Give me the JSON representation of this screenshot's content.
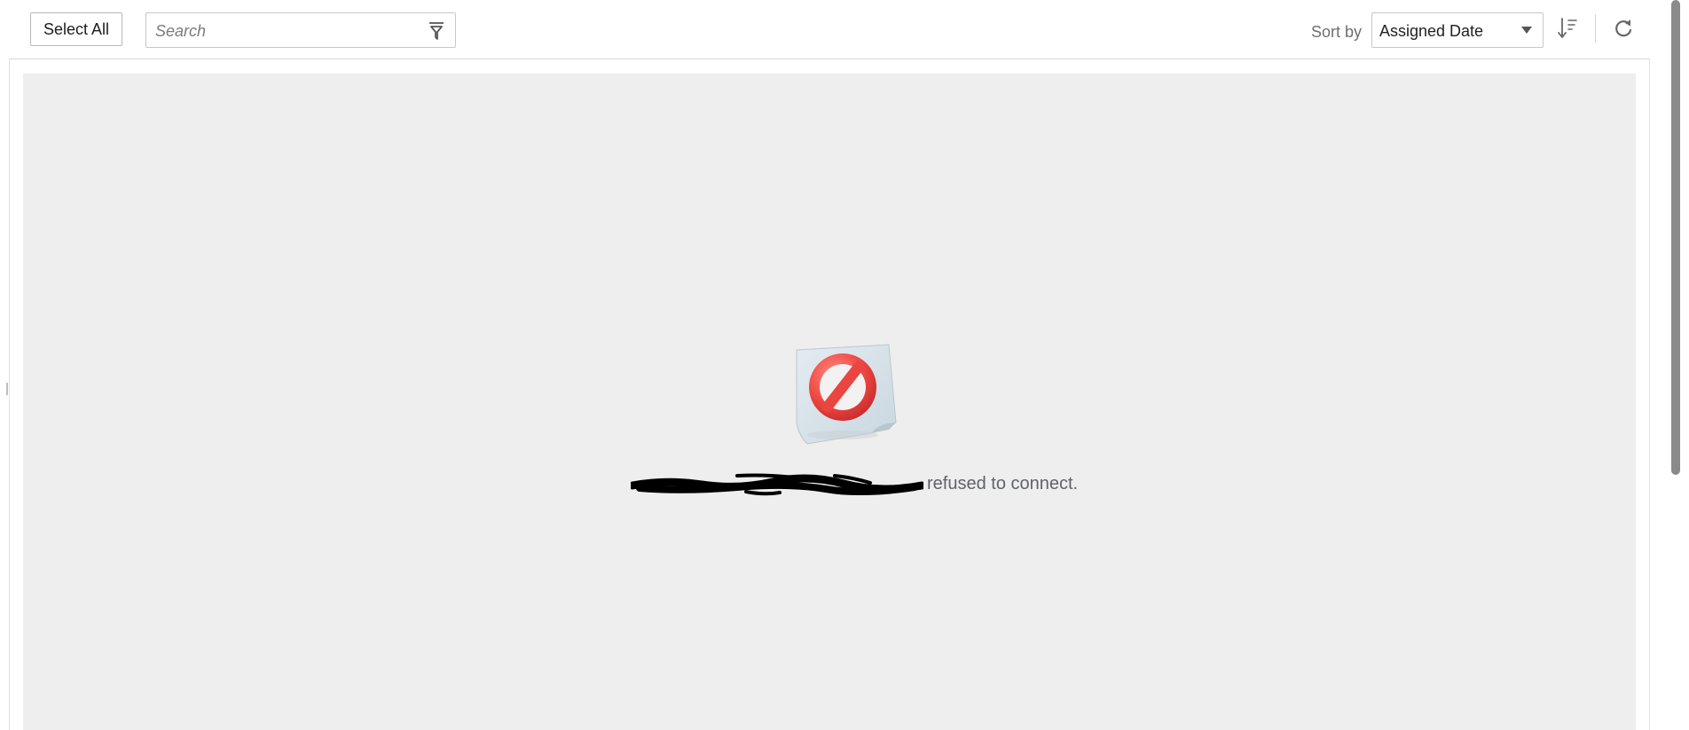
{
  "toolbar": {
    "select_all_label": "Select All",
    "search": {
      "placeholder": "Search",
      "value": "",
      "icon": "filter-icon"
    },
    "sort": {
      "label": "Sort by",
      "selected": "Assigned Date",
      "direction_icon": "sort-descending-icon",
      "refresh_icon": "refresh-icon"
    }
  },
  "error": {
    "icon": "blocked-icon",
    "host_redacted": true,
    "message": "refused to connect."
  },
  "colors": {
    "panel_background": "#eeeeee",
    "blocked_red": "#e8413e",
    "message_text": "#5f6368"
  }
}
